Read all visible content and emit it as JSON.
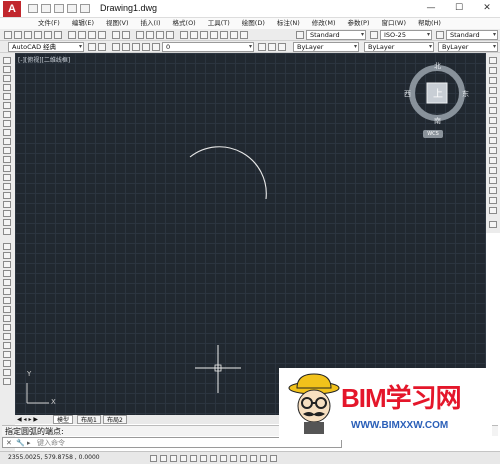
{
  "app": {
    "logo_letter": "A",
    "title": "Drawing1.dwg"
  },
  "window_controls": {
    "minimize": "—",
    "maximize": "☐",
    "close": "✕"
  },
  "menu": [
    "文件(F)",
    "编辑(E)",
    "视图(V)",
    "插入(I)",
    "格式(O)",
    "工具(T)",
    "绘图(D)",
    "标注(N)",
    "修改(M)",
    "参数(P)",
    "窗口(W)",
    "帮助(H)"
  ],
  "toolbar1": {
    "text_style": "Standard",
    "dim_style": "ISO-25",
    "table_style": "Standard"
  },
  "toolbar2": {
    "workspace": "AutoCAD 经典",
    "layer": "0",
    "color": "ByLayer",
    "linetype": "ByLayer",
    "lineweight": "ByLayer"
  },
  "canvas": {
    "viewport_label": "[-][俯视][二维线框]",
    "viewcube": {
      "north": "北",
      "south": "南",
      "east": "东",
      "west": "西",
      "face": "上"
    },
    "wcs": "WCS",
    "ucs": {
      "x": "X",
      "y": "Y"
    }
  },
  "tabs": [
    "模型",
    "布局1",
    "布局2"
  ],
  "command": {
    "history": "指定圆弧的端点:",
    "placeholder": "键入命令"
  },
  "status": {
    "coords": "2355.0025, 579.8758 , 0.0000"
  },
  "watermark": {
    "brand": "BIM学习网",
    "url": "WWW.BIMXXW.COM"
  },
  "colors": {
    "canvas_bg": "#212830",
    "accent_red": "#c1272d",
    "watermark_red": "#e4162a",
    "watermark_blue": "#2a5fb8"
  }
}
